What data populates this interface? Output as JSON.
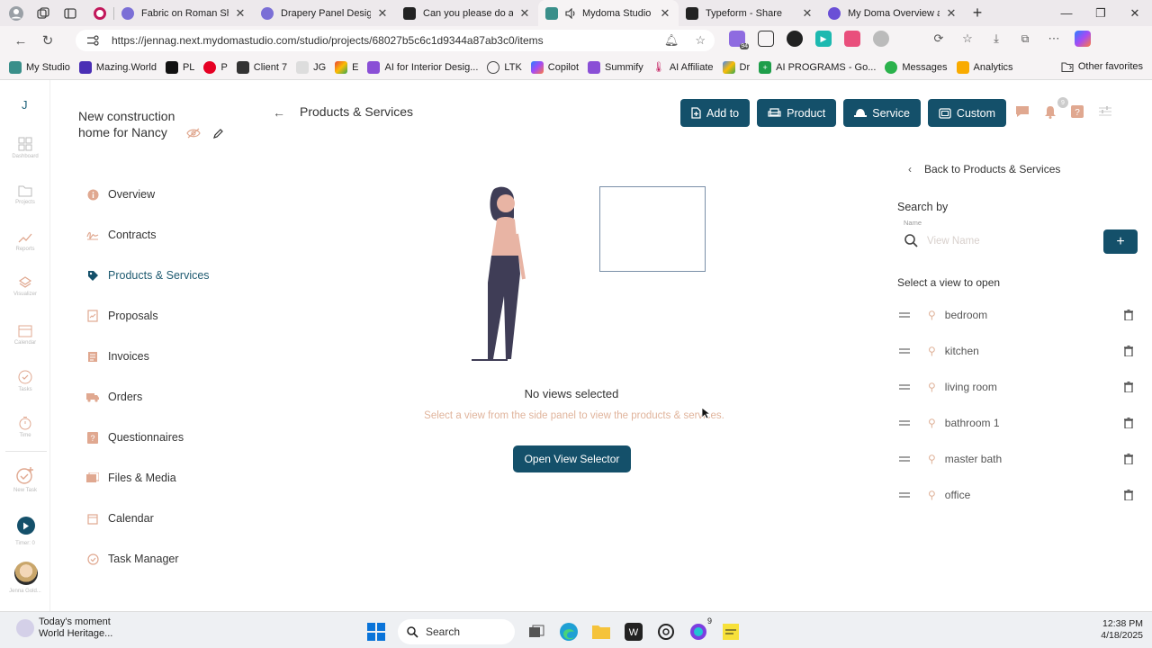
{
  "browser": {
    "tabs": [
      {
        "title": "Fabric on Roman Shade",
        "color": "#7b6fd6"
      },
      {
        "title": "Drapery Panel Design",
        "color": "#7b6fd6"
      },
      {
        "title": "Can you please do a de",
        "color": "#222222"
      },
      {
        "title": "Mydoma Studio",
        "color": "#3a8f8a",
        "active": true
      },
      {
        "title": "Typeform - Share",
        "color": "#222222"
      },
      {
        "title": "My Doma Overview and",
        "color": "#6a4fd6"
      }
    ],
    "url": "https://jennag.next.mydomastudio.com/studio/projects/68027b5c6c1d9344a87ab3c0/items",
    "ext_badge": "94",
    "bookmarks": [
      "My Studio",
      "Mazing.World",
      "PL",
      "P",
      "Client 7",
      "JG",
      "E",
      "AI for Interior Desig...",
      "LTK",
      "Copilot",
      "Summify",
      "AI Affiliate",
      "Dr",
      "AI PROGRAMS - Go...",
      "Messages",
      "Analytics"
    ],
    "other_favorites": "Other favorites"
  },
  "rail": {
    "logo": "J",
    "items": [
      "Dashboard",
      "Projects",
      "Reports",
      "Visualizer",
      "Calendar",
      "Tasks",
      "Time",
      "New Task",
      "Timer: 0",
      "Jenna Gold..."
    ]
  },
  "project": {
    "title": "New construction home for Nancy"
  },
  "sidebar": {
    "items": [
      "Overview",
      "Contracts",
      "Products & Services",
      "Proposals",
      "Invoices",
      "Orders",
      "Questionnaires",
      "Files & Media",
      "Calendar",
      "Task Manager"
    ],
    "active": "Products & Services"
  },
  "main": {
    "title": "Products & Services",
    "empty_title": "No views selected",
    "empty_sub": "Select a view from the side panel to view the products & services.",
    "open_button": "Open View Selector"
  },
  "toolbar": {
    "buttons": [
      "Add to",
      "Product",
      "Service",
      "Custom"
    ],
    "notification_count": "9"
  },
  "panel": {
    "back": "Back to Products & Services",
    "search_by": "Search by",
    "search_sub": "Name",
    "search_placeholder": "View Name",
    "add_label": "+",
    "select_label": "Select a view to open",
    "views": [
      "bedroom",
      "kitchen",
      "living room",
      "bathroom 1",
      "master bath",
      "office"
    ]
  },
  "taskbar": {
    "weather_title": "Today's moment",
    "weather_sub": "World Heritage...",
    "search": "Search",
    "time": "12:38 PM",
    "date": "4/18/2025",
    "copilot_badge": "9"
  },
  "colors": {
    "accent": "#14506a",
    "muted_orange": "#e0b49c"
  }
}
